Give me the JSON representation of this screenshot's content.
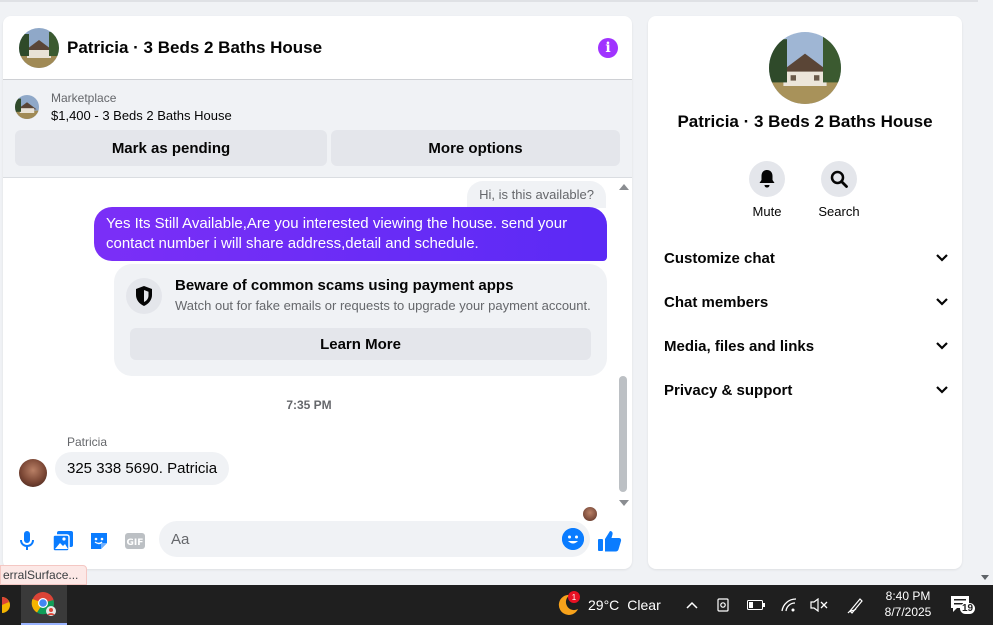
{
  "colors": {
    "accent": "#0a7cff",
    "outgoing_bubble": "#6b2cf5",
    "info_icon": "#a033ff",
    "panel_bg": "#ffffff",
    "page_bg": "#f0f2f5"
  },
  "chat": {
    "title": "Patricia · 3 Beds 2 Baths House",
    "info_icon": "info-icon",
    "marketplace": {
      "label": "Marketplace",
      "listing": "$1,400 - 3 Beds 2 Baths House",
      "buttons": {
        "pending": "Mark as pending",
        "more": "More options"
      }
    },
    "messages": {
      "incoming_first": "Hi, is this available?",
      "outgoing": "Yes Its Still Available,Are you interested viewing the house. send your contact number i will share address,detail and schedule.",
      "scam_warning": {
        "title": "Beware of common scams using payment apps",
        "subtitle": "Watch out for fake emails or requests to upgrade your payment account.",
        "button": "Learn More"
      },
      "timestamp": "7:35 PM",
      "sender": "Patricia",
      "incoming_last": "325 338 5690.  Patricia"
    },
    "composer": {
      "placeholder": "Aa",
      "icons": [
        "microphone-icon",
        "photo-icon",
        "sticker-icon",
        "gif-icon",
        "emoji-icon",
        "thumbs-up-icon"
      ],
      "gif_label": "GIF"
    }
  },
  "info_panel": {
    "title": "Patricia · 3 Beds 2 Baths House",
    "actions": {
      "mute": "Mute",
      "search": "Search"
    },
    "sections": [
      "Customize chat",
      "Chat members",
      "Media, files and links",
      "Privacy & support"
    ]
  },
  "tooltip": "erralSurface...",
  "taskbar": {
    "weather_temp": "29°C",
    "weather_cond": "Clear",
    "weather_badge": "1",
    "time": "8:40 PM",
    "date": "8/7/2025",
    "notification_count": "19"
  }
}
